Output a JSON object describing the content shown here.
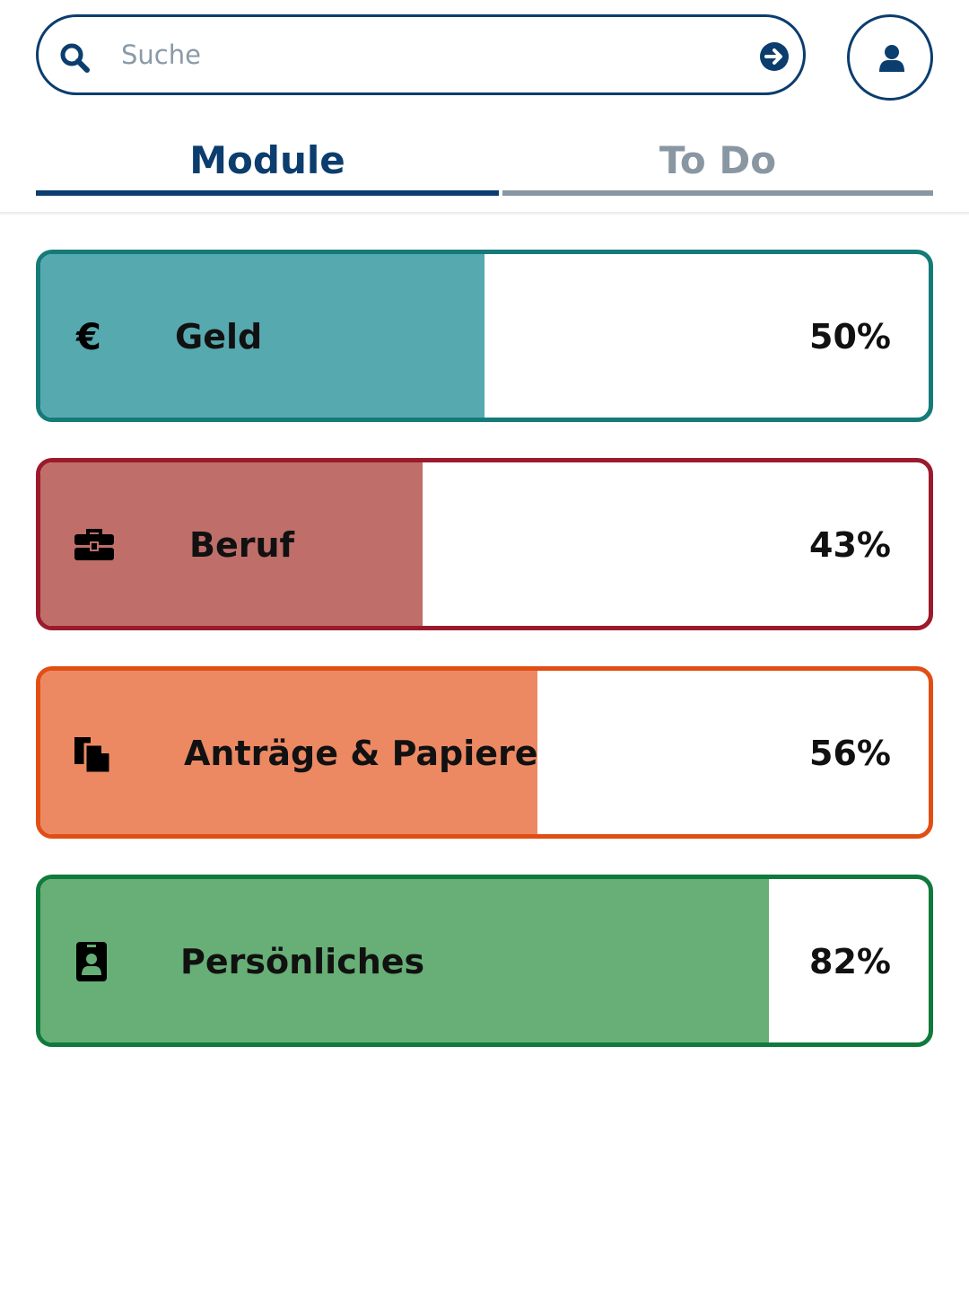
{
  "search": {
    "placeholder": "Suche",
    "value": ""
  },
  "tabs": [
    {
      "label": "Module",
      "active": true
    },
    {
      "label": "To Do",
      "active": false
    }
  ],
  "modules": [
    {
      "label": "Geld",
      "progress_percent": 50,
      "progress_label": "50%",
      "icon": "euro-icon",
      "border_color": "#147b78",
      "fill_color": "#57a9b0"
    },
    {
      "label": "Beruf",
      "progress_percent": 43,
      "progress_label": "43%",
      "icon": "briefcase-icon",
      "border_color": "#9b1a2c",
      "fill_color": "#bf6e69"
    },
    {
      "label": "Anträge & Papiere",
      "progress_percent": 56,
      "progress_label": "56%",
      "icon": "documents-icon",
      "border_color": "#e14e14",
      "fill_color": "#ec8963"
    },
    {
      "label": "Persönliches",
      "progress_percent": 82,
      "progress_label": "82%",
      "icon": "id-badge-icon",
      "border_color": "#0f7a3c",
      "fill_color": "#67af76"
    }
  ],
  "colors": {
    "primary": "#0b3d6e",
    "inactive_tab": "#8997a3"
  }
}
